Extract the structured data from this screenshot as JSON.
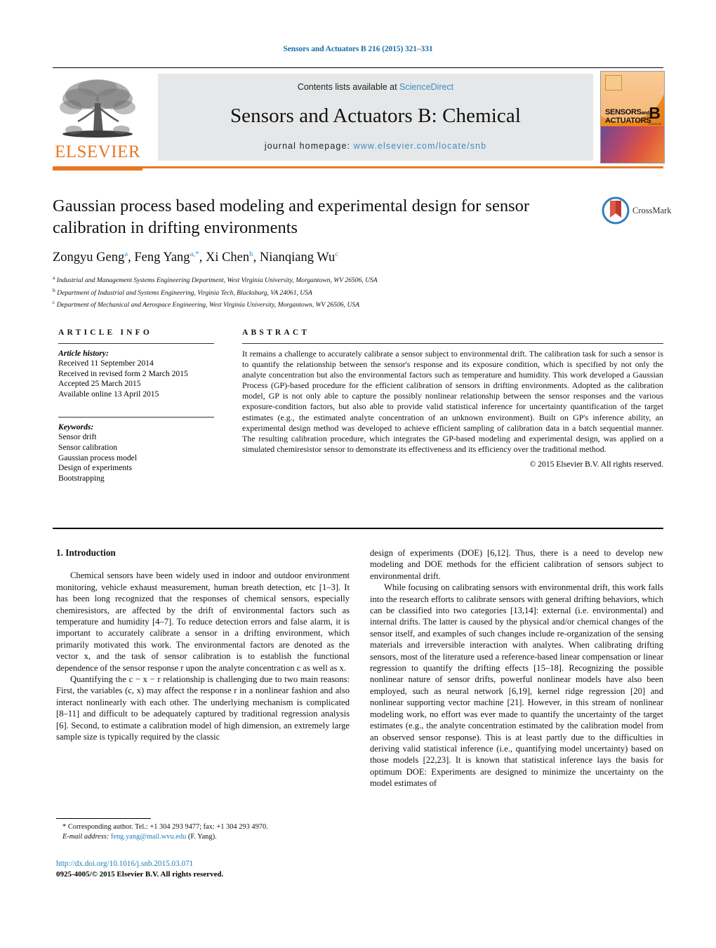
{
  "running_head": "Sensors and Actuators B 216 (2015) 321–331",
  "masthead": {
    "contents_prefix": "Contents lists available at ",
    "contents_link": "ScienceDirect",
    "journal_title": "Sensors and Actuators B: Chemical",
    "homepage_prefix": "journal homepage: ",
    "homepage_url": "www.elsevier.com/locate/snb",
    "publisher_logo_text": "ELSEVIER",
    "cover": {
      "line1": "SENSORS",
      "line1_and": "and",
      "line2": "ACTUATORS",
      "letter": "B",
      "sublabel": "Chemical"
    }
  },
  "article": {
    "title": "Gaussian process based modeling and experimental design for sensor calibration in drifting environments",
    "crossmark_label": "CrossMark",
    "authors": [
      {
        "name": "Zongyu Geng",
        "sup": "a"
      },
      {
        "name": "Feng Yang",
        "sup": "a,*"
      },
      {
        "name": "Xi Chen",
        "sup": "b"
      },
      {
        "name": "Nianqiang Wu",
        "sup": "c"
      }
    ],
    "affiliations": [
      {
        "marker": "a",
        "text": "Industrial and Management Systems Engineering Department, West Virginia University, Morgantown, WV 26506, USA"
      },
      {
        "marker": "b",
        "text": "Department of Industrial and Systems Engineering, Virginia Tech, Blacksburg, VA 24061, USA"
      },
      {
        "marker": "c",
        "text": "Department of Mechanical and Aerospace Engineering, West Virginia University, Morgantown, WV 26506, USA"
      }
    ]
  },
  "article_info": {
    "heading": "ARTICLE INFO",
    "history_label": "Article history:",
    "history": [
      "Received 11 September 2014",
      "Received in revised form 2 March 2015",
      "Accepted 25 March 2015",
      "Available online 13 April 2015"
    ],
    "keywords_label": "Keywords:",
    "keywords": [
      "Sensor drift",
      "Sensor calibration",
      "Gaussian process model",
      "Design of experiments",
      "Bootstrapping"
    ]
  },
  "abstract": {
    "heading": "ABSTRACT",
    "body": "It remains a challenge to accurately calibrate a sensor subject to environmental drift. The calibration task for such a sensor is to quantify the relationship between the sensor's response and its exposure condition, which is specified by not only the analyte concentration but also the environmental factors such as temperature and humidity. This work developed a Gaussian Process (GP)-based procedure for the efficient calibration of sensors in drifting environments. Adopted as the calibration model, GP is not only able to capture the possibly nonlinear relationship between the sensor responses and the various exposure-condition factors, but also able to provide valid statistical inference for uncertainty quantification of the target estimates (e.g., the estimated analyte concentration of an unknown environment). Built on GP's inference ability, an experimental design method was developed to achieve efficient sampling of calibration data in a batch sequential manner. The resulting calibration procedure, which integrates the GP-based modeling and experimental design, was applied on a simulated chemiresistor sensor to demonstrate its effectiveness and its efficiency over the traditional method.",
    "copyright": "© 2015 Elsevier B.V. All rights reserved."
  },
  "body": {
    "section_number_title": "1.  Introduction",
    "left_paragraphs": [
      "Chemical sensors have been widely used in indoor and outdoor environment monitoring, vehicle exhaust measurement, human breath detection, etc [1–3]. It has been long recognized that the responses of chemical sensors, especially chemiresistors, are affected by the drift of environmental factors such as temperature and humidity [4–7]. To reduce detection errors and false alarm, it is important to accurately calibrate a sensor in a drifting environment, which primarily motivated this work. The environmental factors are denoted as the vector x, and the task of sensor calibration is to establish the functional dependence of the sensor response r upon the analyte concentration c as well as x.",
      "Quantifying the c − x − r relationship is challenging due to two main reasons: First, the variables (c, x) may affect the response r in a nonlinear fashion and also interact nonlinearly with each other. The underlying mechanism is complicated [8–11] and difficult to be adequately captured by traditional regression analysis [6]. Second, to estimate a calibration model of high dimension, an extremely large sample size is typically required by the classic"
    ],
    "right_paragraphs": [
      "design of experiments (DOE) [6,12]. Thus, there is a need to develop new modeling and DOE methods for the efficient calibration of sensors subject to environmental drift.",
      "While focusing on calibrating sensors with environmental drift, this work falls into the research efforts to calibrate sensors with general drifting behaviors, which can be classified into two categories [13,14]: external (i.e. environmental) and internal drifts. The latter is caused by the physical and/or chemical changes of the sensor itself, and examples of such changes include re-organization of the sensing materials and irreversible interaction with analytes. When calibrating drifting sensors, most of the literature used a reference-based linear compensation or linear regression to quantify the drifting effects [15–18]. Recognizing the possible nonlinear nature of sensor drifts, powerful nonlinear models have also been employed, such as neural network [6,19], kernel ridge regression [20] and nonlinear supporting vector machine [21]. However, in this stream of nonlinear modeling work, no effort was ever made to quantify the uncertainty of the target estimates (e.g., the analyte concentration estimated by the calibration model from an observed sensor response). This is at least partly due to the difficulties in deriving valid statistical inference (i.e., quantifying model uncertainty) based on those models [22,23]. It is known that statistical inference lays the basis for optimum DOE: Experiments are designed to minimize the uncertainty on the model estimates of"
    ]
  },
  "footer": {
    "corresponding_marker": "*",
    "corresponding_text": "Corresponding author. Tel.: +1 304 293 9477; fax: +1 304 293 4970.",
    "email_label": "E-mail address:",
    "email": "feng.yang@mail.wvu.edu",
    "email_suffix": "(F. Yang).",
    "doi": "http://dx.doi.org/10.1016/j.snb.2015.03.071",
    "issn_line": "0925-4005/© 2015 Elsevier B.V. All rights reserved."
  },
  "colors": {
    "link_blue": "#1a7fb5",
    "header_blue": "#1a6ea8",
    "elsevier_orange": "#E87722",
    "band_grey": "#e6e7e8"
  }
}
